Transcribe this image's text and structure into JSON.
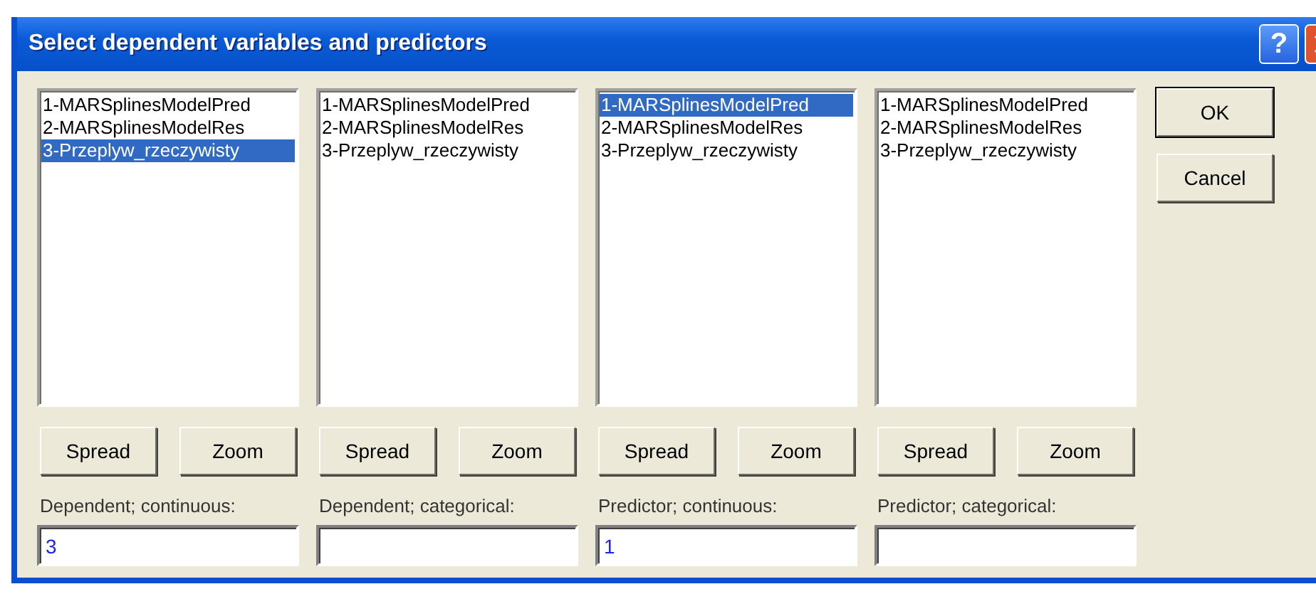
{
  "window": {
    "title": "Select dependent variables and predictors",
    "help_icon": "?"
  },
  "columns": [
    {
      "items": [
        {
          "label": "1-MARSplinesModelPred",
          "selected": false
        },
        {
          "label": "2-MARSplinesModelRes",
          "selected": false
        },
        {
          "label": "3-Przeplyw_rzeczywisty",
          "selected": true
        }
      ],
      "buttons": [
        "Spread",
        "Zoom"
      ],
      "label": "Dependent; continuous:",
      "value": "3"
    },
    {
      "items": [
        {
          "label": "1-MARSplinesModelPred",
          "selected": false
        },
        {
          "label": "2-MARSplinesModelRes",
          "selected": false
        },
        {
          "label": "3-Przeplyw_rzeczywisty",
          "selected": false
        }
      ],
      "buttons": [
        "Spread",
        "Zoom"
      ],
      "label": "Dependent; categorical:"
    },
    {
      "items": [
        {
          "label": "1-MARSplinesModelPred",
          "selected": true
        },
        {
          "label": "2-MARSplinesModelRes",
          "selected": false
        },
        {
          "label": "3-Przeplyw_rzeczywisty",
          "selected": false
        }
      ],
      "buttons": [
        "Spread",
        "Zoom"
      ],
      "label": "Predictor; continuous:",
      "value": "1"
    },
    {
      "items": [
        {
          "label": "1-MARSplinesModelPred",
          "selected": false
        },
        {
          "label": "2-MARSplinesModelRes",
          "selected": false
        },
        {
          "label": "3-Przeplyw_rzeczywisty",
          "selected": false
        }
      ],
      "buttons": [
        "Spread",
        "Zoom"
      ],
      "label": "Predictor; categorical:"
    }
  ],
  "buttons": [
    {
      "label": "OK",
      "default": true
    },
    {
      "label": "Cancel",
      "default": false
    }
  ]
}
